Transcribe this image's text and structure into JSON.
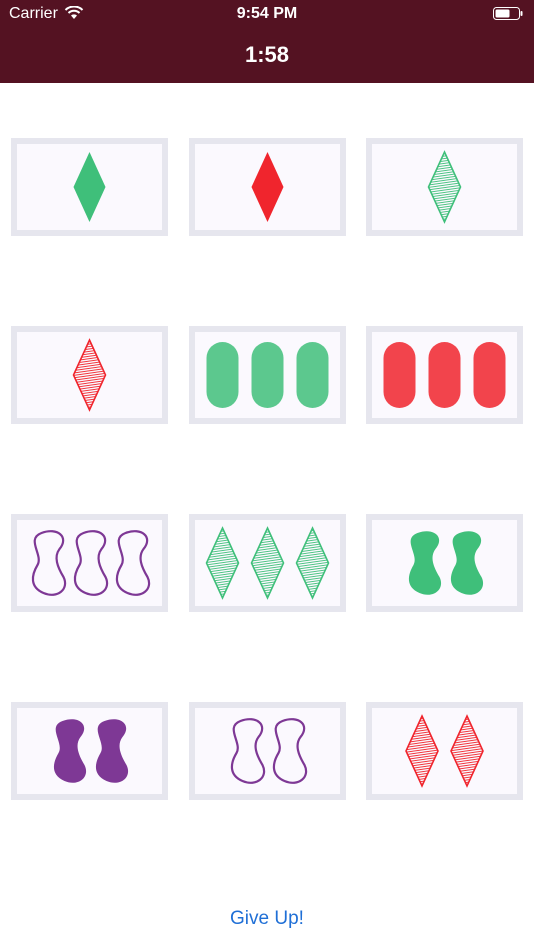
{
  "status_bar": {
    "carrier": "Carrier",
    "time": "9:54 PM"
  },
  "header": {
    "timer": "1:58",
    "background": "#541222"
  },
  "colors": {
    "green": "#3fbf7a",
    "red": "#f0252d",
    "purple": "#7e3895"
  },
  "cards": [
    {
      "count": 1,
      "shape": "diamond",
      "color": "green",
      "fill": "solid"
    },
    {
      "count": 1,
      "shape": "diamond",
      "color": "red",
      "fill": "solid"
    },
    {
      "count": 1,
      "shape": "diamond",
      "color": "green",
      "fill": "striped"
    },
    {
      "count": 1,
      "shape": "diamond",
      "color": "red",
      "fill": "striped"
    },
    {
      "count": 3,
      "shape": "oval",
      "color": "green",
      "fill": "solid"
    },
    {
      "count": 3,
      "shape": "oval",
      "color": "red",
      "fill": "solid"
    },
    {
      "count": 3,
      "shape": "squiggle",
      "color": "purple",
      "fill": "outline"
    },
    {
      "count": 3,
      "shape": "diamond",
      "color": "green",
      "fill": "striped"
    },
    {
      "count": 2,
      "shape": "squiggle",
      "color": "green",
      "fill": "solid"
    },
    {
      "count": 2,
      "shape": "squiggle",
      "color": "purple",
      "fill": "solid"
    },
    {
      "count": 2,
      "shape": "squiggle",
      "color": "purple",
      "fill": "outline"
    },
    {
      "count": 2,
      "shape": "diamond",
      "color": "red",
      "fill": "striped"
    }
  ],
  "give_up_label": "Give Up!"
}
